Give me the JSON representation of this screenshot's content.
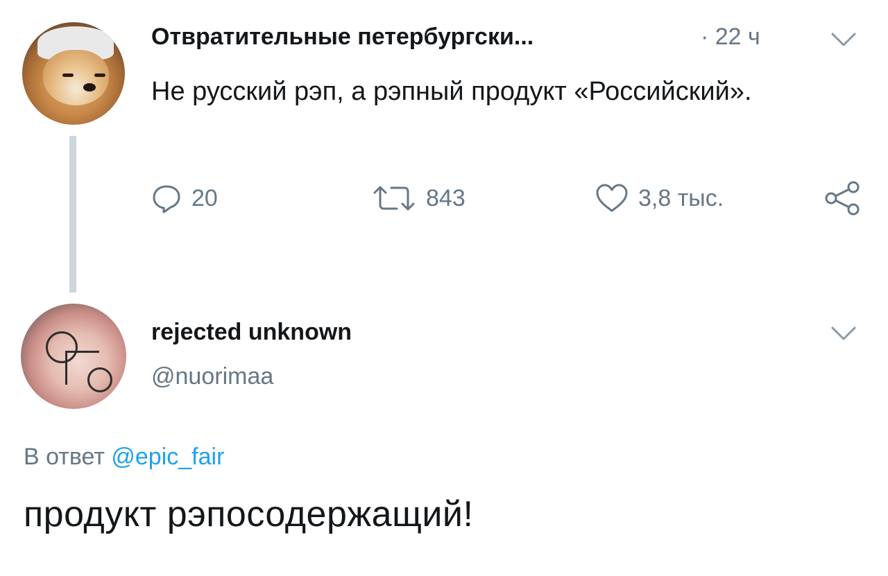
{
  "tweet1": {
    "user_name": "Отвратительные петербургски...",
    "time": "· 22 ч",
    "text": "Не русский рэп, а рэпный продукт «Российский».",
    "actions": {
      "reply_count": "20",
      "retweet_count": "843",
      "like_count": "3,8 тыс."
    },
    "icons": [
      "reply-icon",
      "retweet-icon",
      "like-icon",
      "share-icon",
      "chevron-down-icon"
    ]
  },
  "tweet2": {
    "user_name": "rejected unknown",
    "handle": "@nuorimaa",
    "reply_prefix": "В ответ",
    "reply_mention": "@epic_fair",
    "text": "продукт рэпосодержащий!"
  },
  "colors": {
    "text": "#14171a",
    "secondary": "#657786",
    "link": "#1da1f2",
    "thread_line": "#ccd6dd"
  }
}
